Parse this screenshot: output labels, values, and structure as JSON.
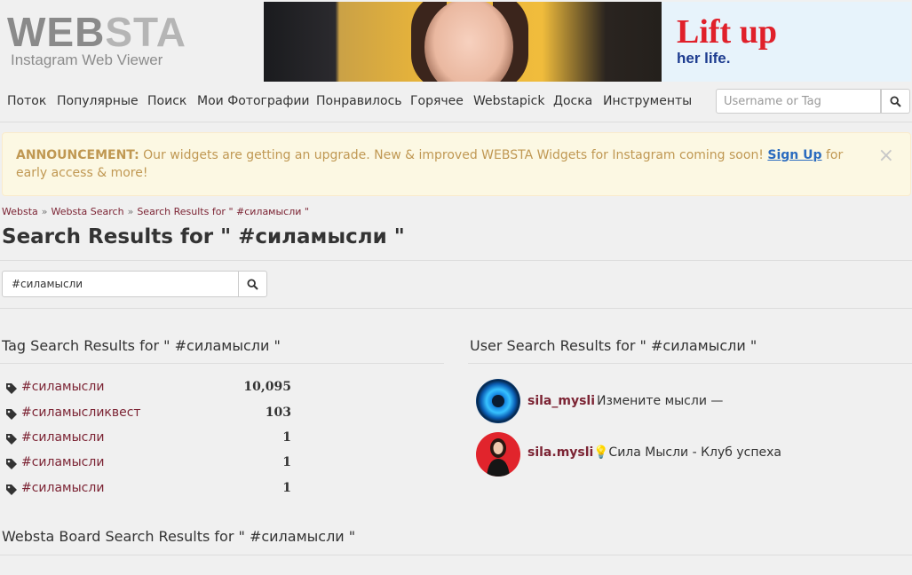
{
  "logo": {
    "part1": "WEB",
    "part2": "STA",
    "subtitle": "Instagram Web Viewer"
  },
  "ad": {
    "headline": "Lift up",
    "subline": "her life."
  },
  "nav": {
    "items": [
      "Поток",
      "Популярные",
      "Поиск",
      "Мои Фотографии",
      "Понравилось",
      "Горячее",
      "Webstapick",
      "Доска",
      "Инструменты"
    ],
    "search_placeholder": "Username or Tag"
  },
  "announcement": {
    "label": "ANNOUNCEMENT:",
    "message": "Our widgets are getting an upgrade. New & improved WEBSTA Widgets for Instagram coming soon!",
    "link": "Sign Up",
    "suffix": "for early access & more!",
    "close": "×"
  },
  "breadcrumb": {
    "items": [
      "Websta",
      "Websta Search",
      "Search Results for \" #силамысли \""
    ],
    "separator": "»"
  },
  "page_title": "Search Results for \" #силамысли \"",
  "search": {
    "value": "#силамысли"
  },
  "tag_results": {
    "title": "Tag Search Results for \" #силамысли \"",
    "items": [
      {
        "tag": "#силамысли",
        "count": "10,095"
      },
      {
        "tag": "#силамысликвест",
        "count": "103"
      },
      {
        "tag": "#силамысли",
        "count": "1"
      },
      {
        "tag": "#силамысли",
        "count": "1"
      },
      {
        "tag": "#силамысли",
        "count": "1"
      }
    ]
  },
  "user_results": {
    "title": "User Search Results for \" #силамысли \"",
    "items": [
      {
        "username": "sila_mysli",
        "bio": "Измените мысли —"
      },
      {
        "username": "sila.mysli",
        "bio": "💡Сила Мысли - Клуб успеха"
      }
    ]
  },
  "board_results": {
    "title": "Websta Board Search Results for \" #силамысли \""
  },
  "colors": {
    "link": "#7c2434",
    "announce_text": "#c09853",
    "announce_bg": "#fcf8e3",
    "signup": "#2a6bbf"
  }
}
